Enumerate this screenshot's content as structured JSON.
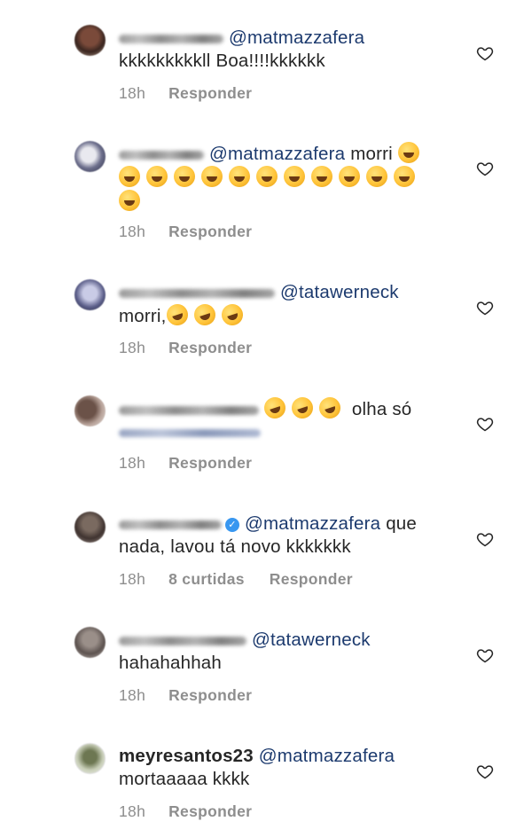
{
  "comments": [
    {
      "avatar": "avatar-blurred",
      "username": "",
      "username_visible": false,
      "verified": false,
      "mention": "@matmazzafera",
      "text_after_mention": "",
      "body_line2": "kkkkkkkkkll Boa!!!!kkkkkk",
      "emoji_count_line1": 0,
      "emoji_count_line2": 0,
      "time": "18h",
      "likes": "",
      "reply": "Responder",
      "icon": "heart-outline-icon"
    },
    {
      "avatar": "avatar-blurred",
      "username": "",
      "username_visible": false,
      "verified": false,
      "mention": "@matmazzafera",
      "text_after_mention": "morri",
      "emoji_name": "face-with-tears-of-joy",
      "time": "18h",
      "likes": "",
      "reply": "Responder",
      "icon": "heart-outline-icon"
    },
    {
      "avatar": "avatar-blurred",
      "username": "",
      "username_visible": false,
      "verified": false,
      "mention": "@tatawerneck",
      "body_line2": "morri,",
      "emoji_name": "rolling-on-the-floor-laughing",
      "time": "18h",
      "likes": "",
      "reply": "Responder",
      "icon": "heart-outline-icon"
    },
    {
      "avatar": "avatar-blurred",
      "username": "",
      "username_visible": false,
      "verified": false,
      "text_after_emoji": "olha só",
      "emoji_name": "rolling-on-the-floor-laughing",
      "time": "18h",
      "likes": "",
      "reply": "Responder",
      "icon": "heart-outline-icon"
    },
    {
      "avatar": "avatar-blurred",
      "username": "",
      "username_visible": false,
      "verified": true,
      "mention": "@matmazzafera",
      "text_after_mention": "que",
      "body_line2": "nada, lavou tá novo kkkkkkk",
      "time": "18h",
      "likes": "8 curtidas",
      "reply": "Responder",
      "icon": "heart-outline-icon"
    },
    {
      "avatar": "avatar-blurred",
      "username": "",
      "username_visible": false,
      "verified": false,
      "mention": "@tatawerneck",
      "body_line2": "hahahahhah",
      "time": "18h",
      "likes": "",
      "reply": "Responder",
      "icon": "heart-outline-icon"
    },
    {
      "avatar": "avatar-meyresantos23",
      "username": "meyresantos23",
      "username_visible": true,
      "verified": false,
      "mention": "@matmazzafera",
      "body_line2": "mortaaaaa kkkk",
      "time": "18h",
      "likes": "",
      "reply": "Responder",
      "icon": "heart-outline-icon"
    }
  ],
  "colors": {
    "text": "#262626",
    "mention": "#1c3a6e",
    "meta": "#8e8e8e",
    "verified": "#3897f0",
    "background": "#ffffff"
  }
}
